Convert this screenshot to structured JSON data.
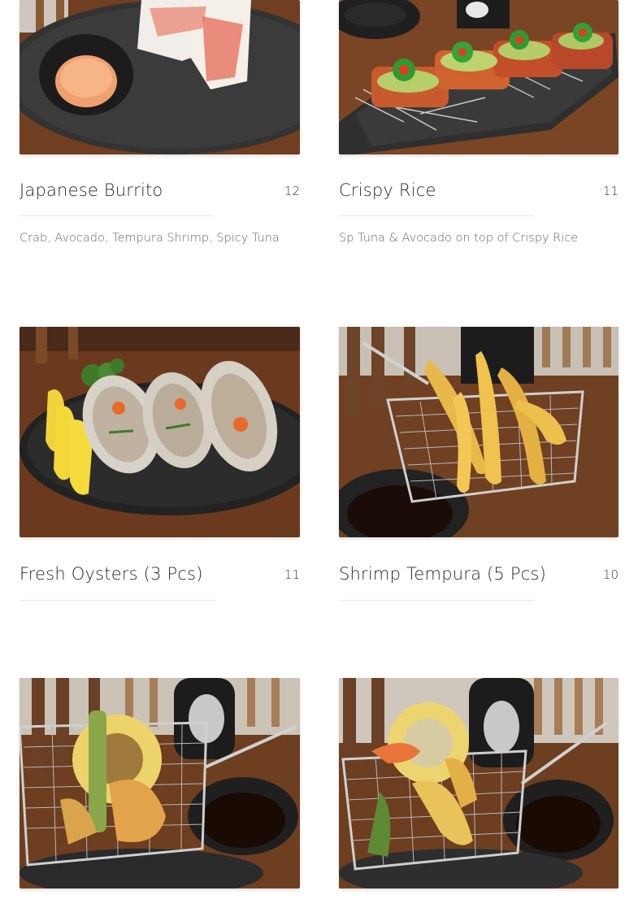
{
  "menu": {
    "items": [
      {
        "name": "Japanese Burrito",
        "price": "12",
        "description": "Crab, Avocado, Tempura Shrimp, Spicy Tuna",
        "image": "japanese-burrito-photo"
      },
      {
        "name": "Crispy Rice",
        "price": "11",
        "description": "Sp Tuna & Avocado on top of Crispy Rice",
        "image": "crispy-rice-photo"
      },
      {
        "name": "Fresh Oysters (3 Pcs)",
        "price": "11",
        "description": "",
        "image": "fresh-oysters-photo"
      },
      {
        "name": "Shrimp Tempura (5 Pcs)",
        "price": "10",
        "description": "",
        "image": "shrimp-tempura-photo"
      },
      {
        "name": "",
        "price": "",
        "description": "",
        "image": "vegetable-tempura-photo"
      },
      {
        "name": "",
        "price": "",
        "description": "",
        "image": "mixed-tempura-photo"
      }
    ]
  },
  "colors": {
    "wood": "#6b3a1e",
    "plate": "#2f2f2f",
    "tempura": "#e4b64a",
    "text": "#2a2a2a"
  }
}
